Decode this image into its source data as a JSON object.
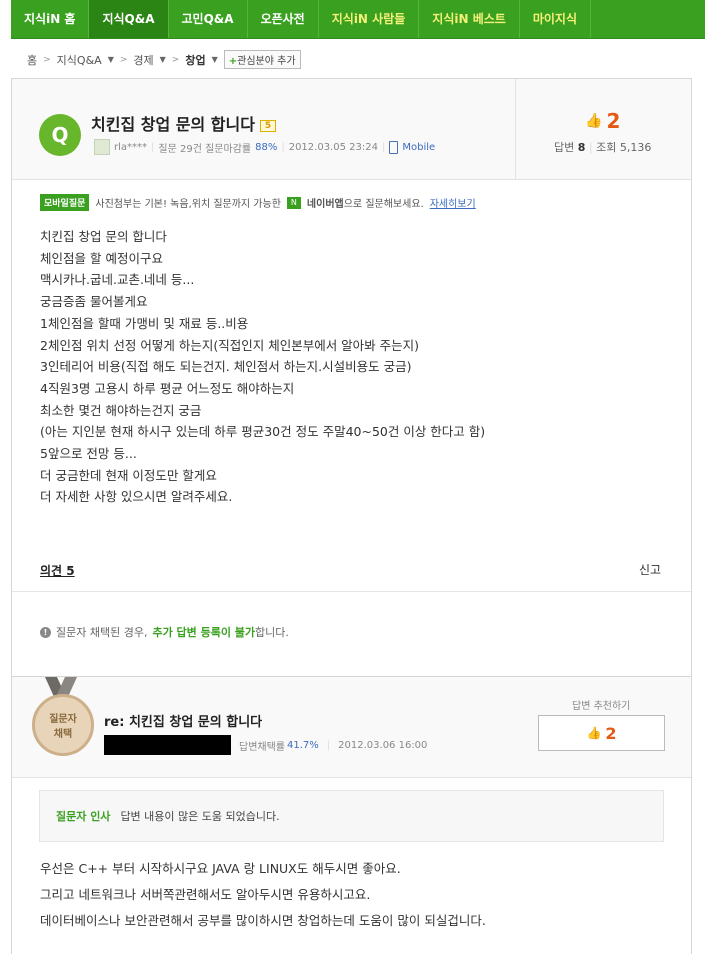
{
  "nav": {
    "tabs": [
      {
        "label": "지식iN 홈"
      },
      {
        "label": "지식Q&A"
      },
      {
        "label": "고민Q&A"
      },
      {
        "label": "오픈사전"
      },
      {
        "label": "지식iN 사람들"
      },
      {
        "label": "지식iN 베스트"
      },
      {
        "label": "마이지식"
      }
    ]
  },
  "breadcrumb": {
    "home": "홈",
    "cat1": "지식Q&A",
    "cat2": "경제",
    "cat3": "창업",
    "add_interest": "관심분야 추가"
  },
  "question": {
    "icon_letter": "Q",
    "title": "치킨집 창업 문의 합니다",
    "badge": "5",
    "user": "rla****",
    "stat_label": "질문 29건 질문마감률",
    "close_rate": "88%",
    "datetime": "2012.03.05 23:24",
    "device": "Mobile",
    "likes": "2",
    "answers_label": "답변",
    "answers": "8",
    "views_label": "조회",
    "views": "5,136",
    "notice_tag": "모바일질문",
    "notice_text1": "사진첨부는 기본! 녹음,위치 질문까지 가능한",
    "notice_app": "네이버앱",
    "notice_text2": "으로 질문해보세요.",
    "notice_link": "자세히보기",
    "body_lines": [
      "치킨집 창업 문의 합니다",
      "체인점을 할 예정이구요",
      "맥시카나.굽네.교촌.네네 등...",
      "궁금증좀 물어볼게요",
      "1체인점을 할때 가맹비 및 재료 등..비용",
      "2체인점 위치 선정 어떻게 하는지(직접인지 체인본부에서 알아봐 주는지)",
      "3인테리어 비용(직접 해도 되는건지. 체인점서 하는지.시설비용도 궁금)",
      "4직원3명 고용시 하루 평균 어느정도 해야하는지",
      "최소한 몇건 해야하는건지 궁금",
      "(아는 지인분 현재 하시구 있는데 하루 평균30건 정도 주말40~50건 이상 한다고 함)",
      "5앞으로 전망 등...",
      "더 궁금한데 현재 이정도만 할게요",
      "더 자세한 사항 있으시면 알려주세요."
    ],
    "opinion": "의견 5",
    "report": "신고",
    "warn_pre": "질문자 채택된 경우,",
    "warn_green": "추가 답변 등록이 불가",
    "warn_post": "합니다."
  },
  "answer": {
    "medal_line1": "질문자",
    "medal_line2": "채택",
    "title": "re: 치킨집 창업 문의 합니다",
    "rate_label": "답변채택률",
    "rate": "41.7%",
    "datetime": "2012.03.06 16:00",
    "recommend_label": "답변 추천하기",
    "recommend_count": "2",
    "greet_label": "질문자 인사",
    "greet_text": "답변 내용이 많은 도움 되었습니다.",
    "body_lines": [
      "우선은 C++ 부터 시작하시구요 JAVA 랑 LINUX도 해두시면 좋아요.",
      "그리고 네트워크나 서버쪽관련해서도 알아두시면 유용하시고요.",
      "데이터베이스나 보안관련해서 공부를 많이하시면 창업하는데 도움이 많이 되실겁니다."
    ]
  }
}
